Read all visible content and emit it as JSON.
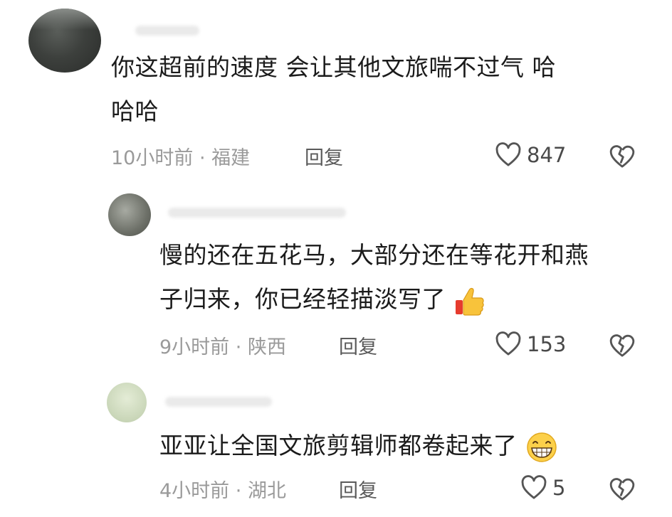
{
  "comments": [
    {
      "text_line1": "你这超前的速度   会让其他文旅喘不过气  哈",
      "text_line2": "哈哈",
      "time": "10小时前",
      "location": "福建",
      "reply_label": "回复",
      "likes": "847",
      "icons": [
        "heart-outline-icon",
        "broken-heart-icon"
      ]
    },
    {
      "text_line1": "慢的还在五花马，大部分还在等花开和燕",
      "text_line2": "子归来，你已经轻描淡写了",
      "emoji": "thumbs-up-icon",
      "time": "9小时前",
      "location": "陕西",
      "reply_label": "回复",
      "likes": "153",
      "icons": [
        "heart-outline-icon",
        "broken-heart-icon"
      ]
    },
    {
      "text_line1": "亚亚让全国文旅剪辑师都卷起来了",
      "emoji": "grin-icon",
      "time": "4小时前",
      "location": "湖北",
      "reply_label": "回复",
      "likes": "5",
      "icons": [
        "heart-outline-icon",
        "broken-heart-icon"
      ]
    }
  ],
  "separator": "·"
}
